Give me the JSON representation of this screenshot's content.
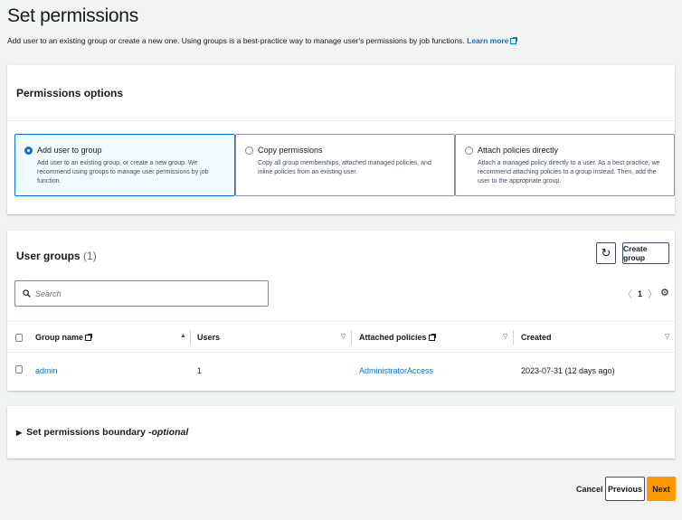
{
  "page": {
    "title": "Set permissions",
    "subtitle": "Add user to an existing group or create a new one. Using groups is a best-practice way to manage user's permissions by job functions.",
    "learn_more": "Learn more"
  },
  "permissions_options": {
    "title": "Permissions options",
    "options": [
      {
        "label": "Add user to group",
        "description": "Add user to an existing group, or create a new group. We recommend using groups to manage user permissions by job function.",
        "selected": true
      },
      {
        "label": "Copy permissions",
        "description": "Copy all group memberships, attached managed policies, and inline policies from an existing user.",
        "selected": false
      },
      {
        "label": "Attach policies directly",
        "description": "Attach a managed policy directly to a user. As a best practice, we recommend attaching policies to a group instead. Then, add the user to the appropriate group.",
        "selected": false
      }
    ]
  },
  "user_groups": {
    "title": "User groups",
    "count": "(1)",
    "refresh_icon": "refresh-icon",
    "create_label": "Create group",
    "search_placeholder": "Search",
    "page_number": "1",
    "columns": [
      "Group name",
      "Users",
      "Attached policies",
      "Created"
    ],
    "rows": [
      {
        "group_name": "admin",
        "users": "1",
        "attached_policies": "AdministratorAccess",
        "created": "2023-07-31 (12 days ago)"
      }
    ]
  },
  "boundary": {
    "label": "Set permissions boundary - ",
    "optional": "optional"
  },
  "footer": {
    "cancel": "Cancel",
    "previous": "Previous",
    "next": "Next"
  },
  "colors": {
    "accent": "#0972d3",
    "primary_button": "#ff9900",
    "background": "#f2f3f3"
  }
}
